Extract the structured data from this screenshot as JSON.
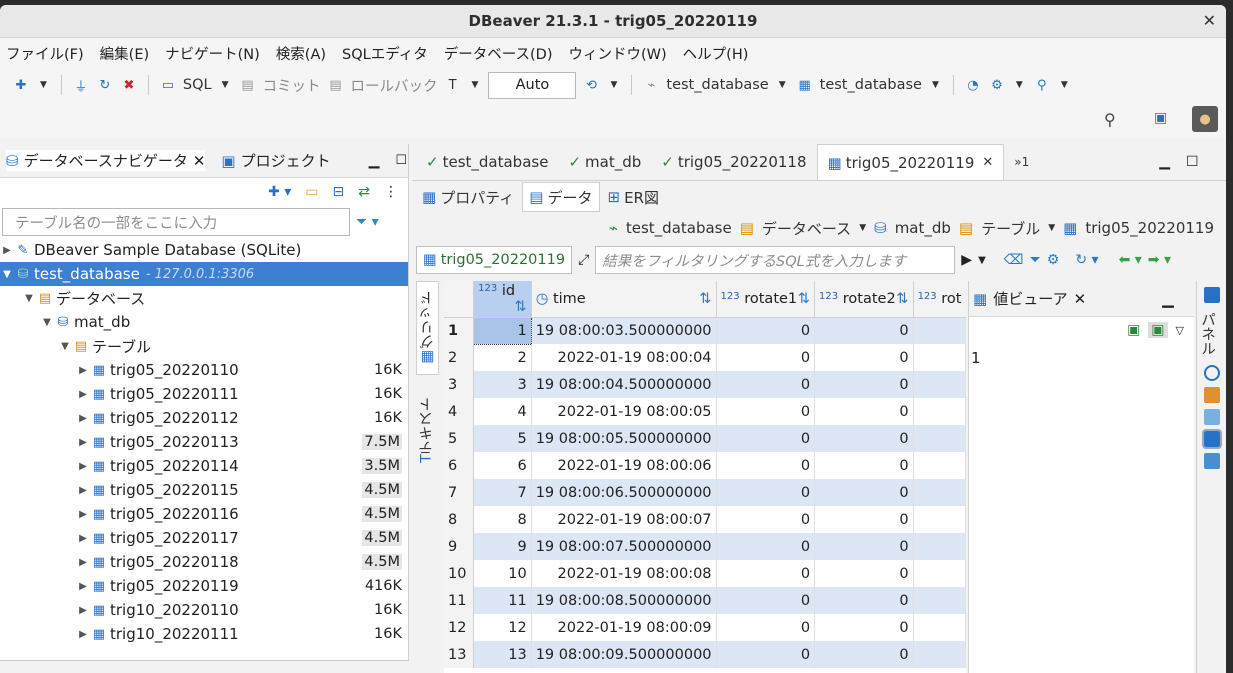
{
  "window": {
    "title": "DBeaver 21.3.1 - trig05_20220119",
    "close": "✕"
  },
  "menu": [
    "ファイル(F)",
    "編集(E)",
    "ナビゲート(N)",
    "検索(A)",
    "SQLエディタ",
    "データベース(D)",
    "ウィンドウ(W)",
    "ヘルプ(H)"
  ],
  "toolbar": {
    "sql": "SQL",
    "commit": "コミット",
    "rollback": "ロールバック",
    "auto": "Auto",
    "datasource": "test_database",
    "schema": "test_database"
  },
  "navigator": {
    "tab_navigator": "データベースナビゲータ",
    "tab_project": "プロジェクト",
    "filter_placeholder": "テーブル名の一部をここに入力",
    "sample_db": "DBeaver Sample Database (SQLite)",
    "connection": "test_database",
    "connection_host": "- 127.0.0.1:3306",
    "databases_folder": "データベース",
    "db": "mat_db",
    "tables_folder": "テーブル",
    "tables": [
      {
        "name": "trig05_20220110",
        "size": "16K"
      },
      {
        "name": "trig05_20220111",
        "size": "16K"
      },
      {
        "name": "trig05_20220112",
        "size": "16K"
      },
      {
        "name": "trig05_20220113",
        "size": "7.5M"
      },
      {
        "name": "trig05_20220114",
        "size": "3.5M"
      },
      {
        "name": "trig05_20220115",
        "size": "4.5M"
      },
      {
        "name": "trig05_20220116",
        "size": "4.5M"
      },
      {
        "name": "trig05_20220117",
        "size": "4.5M"
      },
      {
        "name": "trig05_20220118",
        "size": "4.5M"
      },
      {
        "name": "trig05_20220119",
        "size": "416K"
      },
      {
        "name": "trig10_20220110",
        "size": "16K"
      },
      {
        "name": "trig10_20220111",
        "size": "16K"
      }
    ]
  },
  "editor": {
    "tabs": [
      "test_database",
      "mat_db",
      "trig05_20220118",
      "trig05_20220119",
      "»1"
    ],
    "subtabs": [
      "プロパティ",
      "データ",
      "ER図"
    ],
    "crumbs": [
      "test_database",
      "データベース",
      "mat_db",
      "テーブル",
      "trig05_20220119"
    ],
    "query_tab": "trig05_20220119",
    "sql_filter_placeholder": "結果をフィルタリングするSQL式を入力します",
    "vtab_grid": "グリッド",
    "vtab_text": "テキスト"
  },
  "grid": {
    "columns": [
      "id",
      "time",
      "rotate1",
      "rotate2",
      "rot"
    ],
    "rows": [
      [
        "1",
        "1",
        "19 08:00:03.500000000",
        "0",
        "0"
      ],
      [
        "2",
        "2",
        "2022-01-19 08:00:04",
        "0",
        "0"
      ],
      [
        "3",
        "3",
        "19 08:00:04.500000000",
        "0",
        "0"
      ],
      [
        "4",
        "4",
        "2022-01-19 08:00:05",
        "0",
        "0"
      ],
      [
        "5",
        "5",
        "19 08:00:05.500000000",
        "0",
        "0"
      ],
      [
        "6",
        "6",
        "2022-01-19 08:00:06",
        "0",
        "0"
      ],
      [
        "7",
        "7",
        "19 08:00:06.500000000",
        "0",
        "0"
      ],
      [
        "8",
        "8",
        "2022-01-19 08:00:07",
        "0",
        "0"
      ],
      [
        "9",
        "9",
        "19 08:00:07.500000000",
        "0",
        "0"
      ],
      [
        "10",
        "10",
        "2022-01-19 08:00:08",
        "0",
        "0"
      ],
      [
        "11",
        "11",
        "19 08:00:08.500000000",
        "0",
        "0"
      ],
      [
        "12",
        "12",
        "2022-01-19 08:00:09",
        "0",
        "0"
      ],
      [
        "13",
        "13",
        "19 08:00:09.500000000",
        "0",
        "0"
      ]
    ]
  },
  "value_viewer": {
    "title": "値ビューア",
    "value": "1",
    "panel_label": "パネル"
  }
}
